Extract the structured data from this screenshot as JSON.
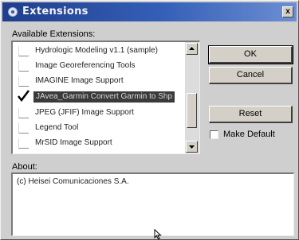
{
  "window": {
    "title": "Extensions",
    "close_glyph": "x"
  },
  "available_label": "Available Extensions:",
  "extensions": [
    {
      "label": "Hydrologic Modeling v1.1 (sample)",
      "checked": false,
      "selected": false
    },
    {
      "label": "Image Georeferencing Tools",
      "checked": false,
      "selected": false
    },
    {
      "label": "IMAGINE Image Support",
      "checked": false,
      "selected": false
    },
    {
      "label": "JAvea_Garmin Convert Garmin to Shp",
      "checked": true,
      "selected": true
    },
    {
      "label": "JPEG (JFIF) Image Support",
      "checked": false,
      "selected": false
    },
    {
      "label": "Legend Tool",
      "checked": false,
      "selected": false
    },
    {
      "label": "MrSID Image Support",
      "checked": false,
      "selected": false
    }
  ],
  "buttons": {
    "ok": "OK",
    "cancel": "Cancel",
    "reset": "Reset"
  },
  "make_default_label": "Make Default",
  "make_default_checked": false,
  "about_label": "About:",
  "about_text": "(c) Heisei Comunicaciones S.A.",
  "colors": {
    "title_start": "#1f3d8c",
    "title_end": "#6d8ed2",
    "selection": "#3a3a3a"
  }
}
